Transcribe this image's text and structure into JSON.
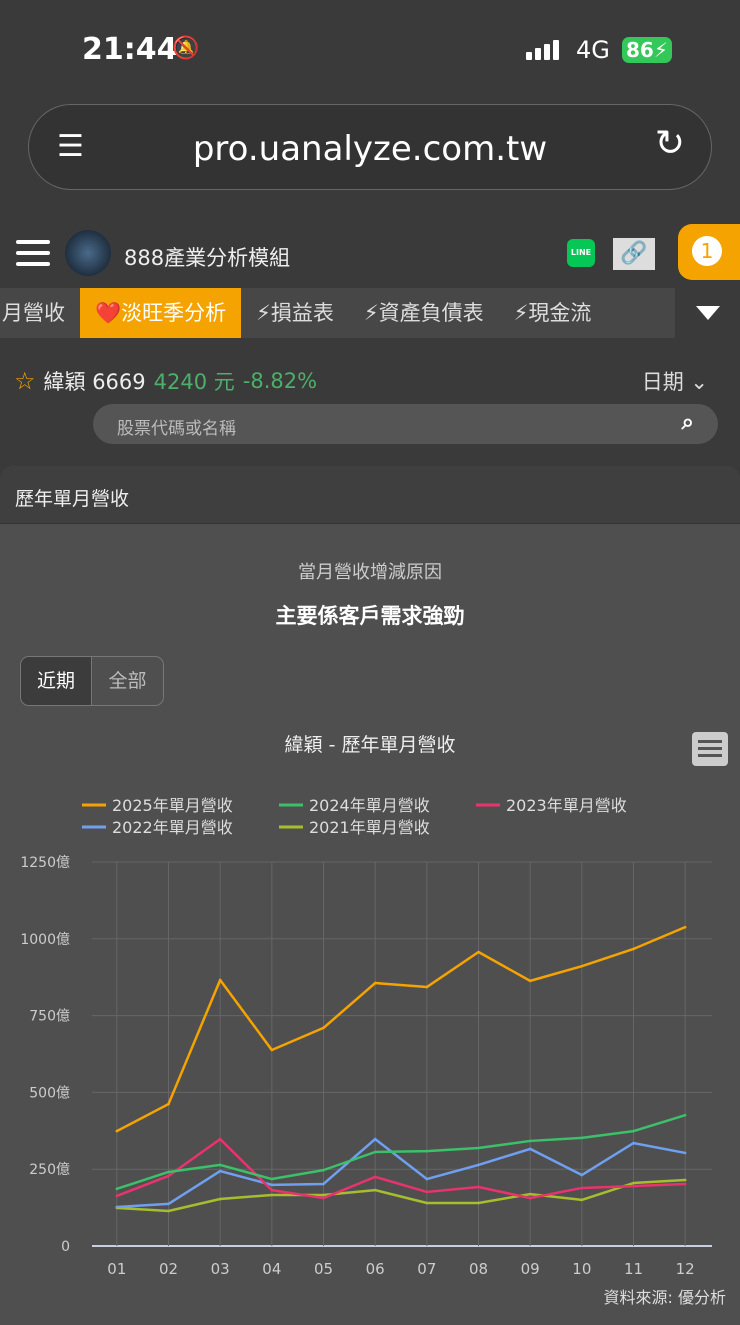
{
  "status": {
    "time": "21:44",
    "network": "4G",
    "battery": "86"
  },
  "browser": {
    "url": "pro.uanalyze.com.tw"
  },
  "app": {
    "title": "888產業分析模組",
    "line": "LINE",
    "notif_count": "1"
  },
  "tabs": [
    "月營收",
    "❤️淡旺季分析",
    "⚡損益表",
    "⚡資產負債表",
    "⚡現金流"
  ],
  "stock": {
    "name": "緯穎 6669",
    "price": "4240 元",
    "change": "-8.82%",
    "date_label": "日期"
  },
  "search": {
    "placeholder": "股票代碼或名稱"
  },
  "panel": {
    "title": "歷年單月營收",
    "reason_label": "當月營收增減原因",
    "reason": "主要係客戶需求強勁",
    "toggle": [
      "近期",
      "全部"
    ],
    "source": "資料來源: 優分析"
  },
  "chart_data": {
    "type": "line",
    "title": "緯穎 - 歷年單月營收",
    "categories": [
      "01",
      "02",
      "03",
      "04",
      "05",
      "06",
      "07",
      "08",
      "09",
      "10",
      "11",
      "12"
    ],
    "yticks": [
      "0",
      "250億",
      "500億",
      "750億",
      "1000億",
      "1250億"
    ],
    "ylim": [
      0,
      1250
    ],
    "legend_position": "top",
    "series": [
      {
        "name": "2025年單月營收",
        "color": "#f5a300",
        "values": [
          374,
          462,
          866,
          638,
          710,
          856,
          843,
          957,
          863,
          911,
          967,
          1038
        ]
      },
      {
        "name": "2024年單月營收",
        "color": "#3cc06a",
        "values": [
          186,
          241,
          264,
          218,
          247,
          306,
          309,
          319,
          342,
          352,
          374,
          426
        ]
      },
      {
        "name": "2023年單月營收",
        "color": "#e8336d",
        "values": [
          163,
          228,
          348,
          182,
          156,
          225,
          176,
          192,
          156,
          189,
          195,
          202
        ]
      },
      {
        "name": "2022年單月營收",
        "color": "#6fa0f0",
        "values": [
          127,
          137,
          244,
          199,
          202,
          348,
          218,
          264,
          316,
          231,
          335,
          303
        ]
      },
      {
        "name": "2021年單月營收",
        "color": "#a6bd2e",
        "values": [
          124,
          114,
          153,
          166,
          166,
          182,
          140,
          140,
          169,
          150,
          205,
          215
        ]
      }
    ]
  }
}
